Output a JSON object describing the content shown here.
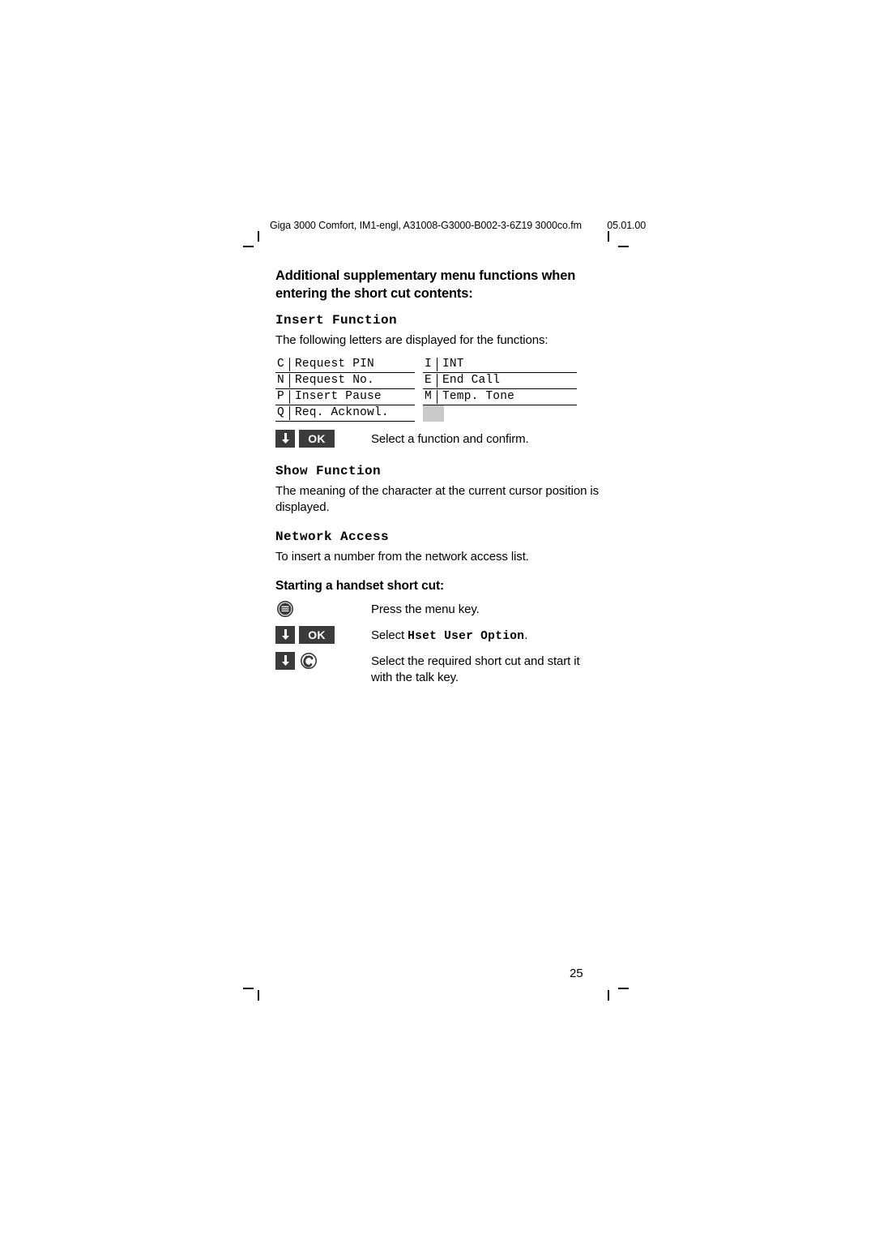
{
  "header": {
    "running_title": "Giga 3000 Comfort, IM1-engl, A31008-G3000-B002-3-6Z19  3000co.fm",
    "date": "05.01.00"
  },
  "content": {
    "section_title": "Additional supplementary menu functions when entering the short cut contents:",
    "insert_function": {
      "heading": "Insert Function",
      "intro": "The following letters are displayed for the functions:",
      "table": [
        {
          "left_key": "C",
          "left_text": "Request PIN",
          "right_key": "I",
          "right_text": "INT"
        },
        {
          "left_key": "N",
          "left_text": "Request No.",
          "right_key": "E",
          "right_text": "End Call"
        },
        {
          "left_key": "P",
          "left_text": "Insert Pause",
          "right_key": "M",
          "right_text": "Temp. Tone"
        },
        {
          "left_key": "Q",
          "left_text": "Req. Acknowl.",
          "right_key": "",
          "right_text": ""
        }
      ],
      "action_text": "Select a function and confirm.",
      "ok_label": "OK"
    },
    "show_function": {
      "heading": "Show Function",
      "text": "The meaning of the character at the current cursor position is displayed."
    },
    "network_access": {
      "heading": "Network Access",
      "text": "To insert a number from the network access list."
    },
    "starting_short_cut": {
      "heading": "Starting a handset short cut:",
      "steps": [
        {
          "desc": "Press the menu key.",
          "ok_label": ""
        },
        {
          "desc_prefix": "Select ",
          "desc_mono": "Hset User Option",
          "desc_suffix": ".",
          "ok_label": "OK"
        },
        {
          "desc": "Select the required short cut and start it with the talk key.",
          "ok_label": ""
        }
      ]
    }
  },
  "page_number": "25"
}
